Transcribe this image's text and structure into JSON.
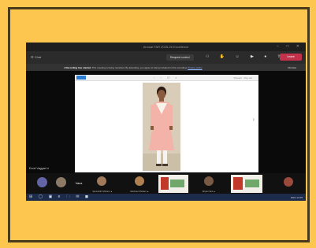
{
  "window": {
    "title": "Annual FAR 2025-26 Excellence"
  },
  "window_controls": [
    "–",
    "□",
    "✕"
  ],
  "toolbar": {
    "chat_label": "Chat",
    "pill_label": "Request control",
    "icons": [
      "people-icon",
      "raise-hand-icon",
      "react-icon",
      "more-icon"
    ],
    "camera_icons": [
      "camera-icon",
      "mic-icon",
      "share-icon"
    ],
    "leave_label": "Leave"
  },
  "recording_bar": {
    "title": "Recording has started.",
    "text": "This meeting is being recorded. By attending, you agree to being included in this recording.",
    "link": "Privacy policy",
    "dismiss": "Dismiss"
  },
  "slide": {
    "toolbar_icons": "‹ › ↺ ⌕",
    "toolbar_right": "Present · Pop out",
    "next_icon": "›"
  },
  "presenter": {
    "label": "Excel Vaggani ▾"
  },
  "participants": [
    {
      "name": "",
      "type": "avatar",
      "color": "#6264a7"
    },
    {
      "name": "",
      "type": "photo"
    },
    {
      "name": "Vaca",
      "type": "text"
    },
    {
      "name": "Samruddhi Shrikant ▲",
      "type": "photo"
    },
    {
      "name": "Vaishnavi Shrikant ▲",
      "type": "photo"
    },
    {
      "name": "",
      "type": "slide"
    },
    {
      "name": "Dhyani Vani ▲",
      "type": "photo"
    },
    {
      "name": "",
      "type": "slide"
    },
    {
      "name": "",
      "type": "photo"
    }
  ],
  "taskbar": {
    "icons": "⊞ ◯ ▣ e 🗀 ✉ ◼",
    "tray": "ENG 12:05"
  }
}
